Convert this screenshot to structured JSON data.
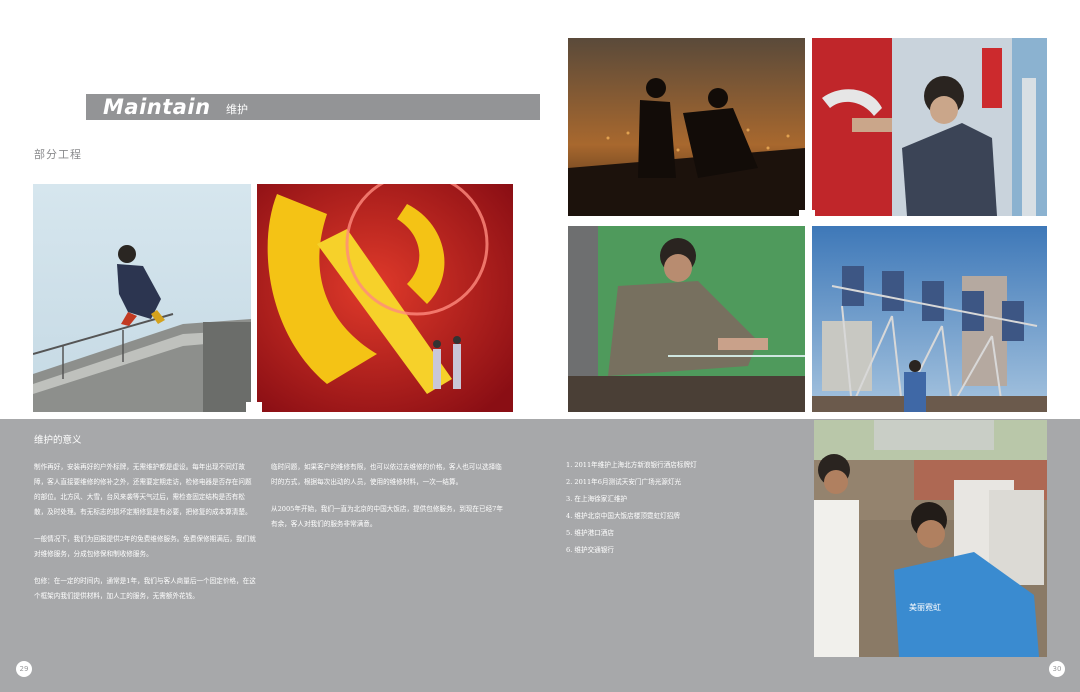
{
  "header": {
    "title_en": "Maintain",
    "title_cn": "维护"
  },
  "section_label": "部分工程",
  "meaning": {
    "title": "维护的意义",
    "col1": [
      "制作再好，安装再好的户外标牌，无需维护都是虚设。每年出现不同灯故障，客人直接要维修的修补之外，还需要定期走访，检修电器是否存在问题的部位。北方风、大雪，台风来袭等天气过后，需检查固定结构是否有松散，及时处理。有无标志的损坏定期修复是有必要，把修复的成本算清楚。",
      "一般情况下，我们为回报提供2年的免费维修服务。免费保修期满后，我们就对维修服务，分成包修保和制收修服务。",
      "包修：在一定的时间内，通常是1年，我们与客人商量后一个固定价格，在这个框架内我们提供材料，加人工的服务，无需额外花钱。"
    ],
    "col2": [
      "临时问题，如果客户的维修有限，也可以依过去维修的价格，客人也可以选择临时的方式，根据每次出动的人员，使用的维修材料，一次一结算。",
      "从2005年开始，我们一直为北京的中国大饭店，提供包修服务，到现在已经7年有余，客人对我们的服务非常满意。"
    ],
    "col3": [
      "1. 2011年维护上海北方新浪银行酒店标牌灯",
      "2. 2011年6月测试天安门广场光源灯光",
      "3. 在上海徐家汇维护",
      "4. 维护北京中国大饭店楼顶霓虹灯招牌",
      "5. 维护港口酒店",
      "6. 维护交通银行"
    ]
  },
  "page_numbers": {
    "left": "29",
    "right": "30"
  },
  "photos": [
    "worker-on-roof-photo",
    "party-emblem-neon-photo",
    "night-silhouette-workers-photo",
    "worker-fixing-sign-photo",
    "worker-wiring-panel-photo",
    "rooftop-letters-frame-photo",
    "rooftop-electrical-box-photo"
  ],
  "photo_text": {
    "shirt_logo": "美丽霓虹"
  },
  "colors": {
    "band_gray": "#939496",
    "bottom_gray": "#a7a8aa",
    "text_white": "#ffffff"
  }
}
